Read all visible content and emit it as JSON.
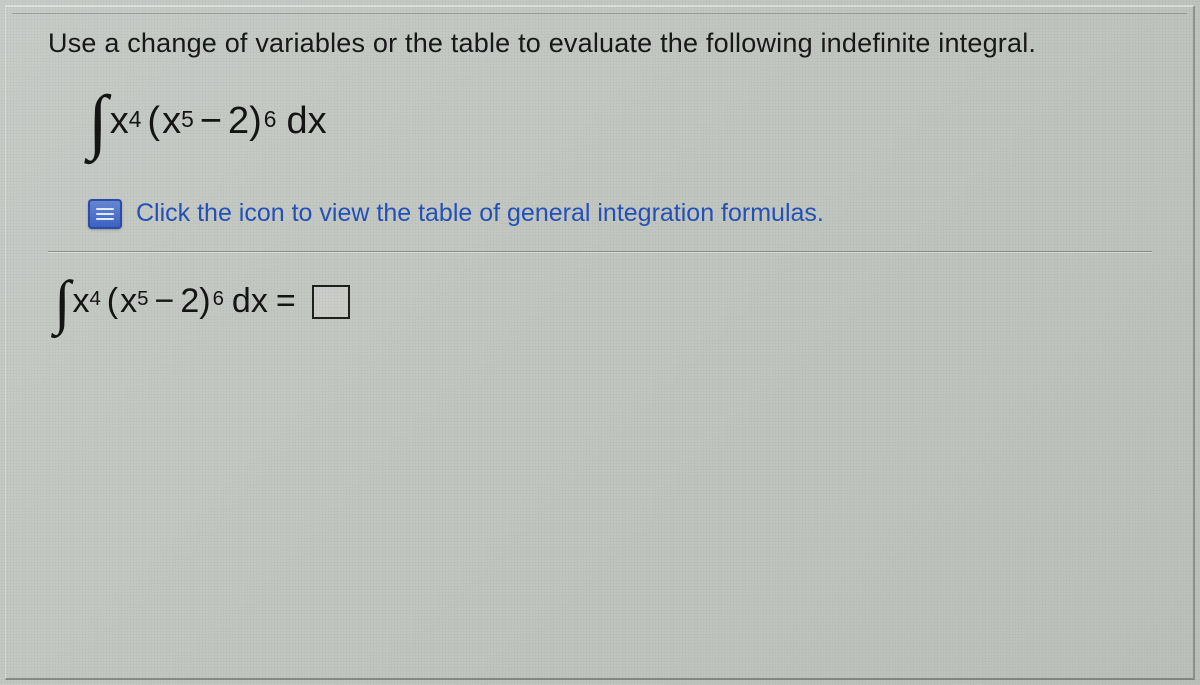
{
  "instruction": "Use a change of variables or the table to evaluate the following indefinite integral.",
  "integral": {
    "coef_base": "x",
    "coef_exp": "4",
    "open_paren": "(",
    "inner_base": "x",
    "inner_exp": "5",
    "minus": "−",
    "const": "2",
    "close_paren": ")",
    "outer_exp": "6",
    "dx": "dx"
  },
  "link_text": "Click the icon to view the table of general integration formulas.",
  "equals": "=",
  "answer_placeholder": ""
}
